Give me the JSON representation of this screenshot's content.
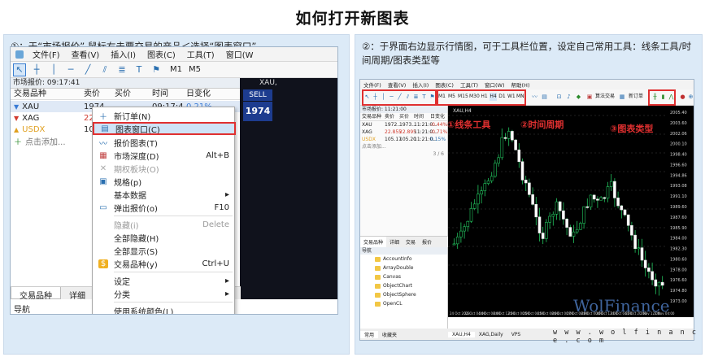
{
  "title": "如何打开新图表",
  "left": {
    "caption": "①：于“市场报价” 鼠标右击要交易的产品＜选择“图表窗口”",
    "menubar": [
      "文件(F)",
      "查看(V)",
      "插入(I)",
      "图表(C)",
      "工具(T)",
      "窗口(W"
    ],
    "timeframes": [
      "M1",
      "M5"
    ],
    "market_watch_header": "市场报价: 09:17:41",
    "columns": [
      "交易品种",
      "卖价",
      "买价",
      "时间",
      "日变化"
    ],
    "rows": [
      {
        "symbol": "XAU",
        "bid": "1974",
        "ask": "",
        "time": "09:17:4",
        "change": "0.21%",
        "color": "#3a7bd5"
      },
      {
        "symbol": "XAG",
        "bid": "22",
        "ask": "",
        "time": "",
        "change": "",
        "color": "#d23b2f"
      },
      {
        "symbol": "USDX",
        "bid": "10",
        "ask": "",
        "time": "",
        "change": "",
        "color": "#e0a020"
      }
    ],
    "add_symbol": "点击添加...",
    "chart_title": "XAU,",
    "sell_label": "SELL",
    "sell_price": "1974",
    "bottom_tabs": [
      "交易品种",
      "详细"
    ],
    "navigator_label": "导航",
    "context_menu": [
      {
        "label": "新订单(N)",
        "shortcut": "",
        "icon": "＋"
      },
      {
        "label": "图表窗口(C)",
        "shortcut": "",
        "icon": "▤"
      },
      {
        "label": "报价图表(T)",
        "shortcut": "",
        "icon": "〰"
      },
      {
        "label": "市场深度(D)",
        "shortcut": "Alt+B",
        "icon": "▦"
      },
      {
        "label": "期权板块(O)",
        "shortcut": "",
        "icon": "✕"
      },
      {
        "label": "规格(p)",
        "shortcut": "",
        "icon": "▣"
      },
      {
        "label": "基本数据",
        "shortcut": "▸",
        "icon": ""
      },
      {
        "label": "弹出报价(o)",
        "shortcut": "F10",
        "icon": "▭"
      },
      {
        "label": "隐藏(i)",
        "shortcut": "Delete",
        "icon": ""
      },
      {
        "label": "全部隐藏(H)",
        "shortcut": "",
        "icon": ""
      },
      {
        "label": "全部显示(S)",
        "shortcut": "",
        "icon": ""
      },
      {
        "label": "交易品种(y)",
        "shortcut": "Ctrl+U",
        "icon": "$"
      },
      {
        "label": "设定",
        "shortcut": "▸",
        "icon": ""
      },
      {
        "label": "分类",
        "shortcut": "▸",
        "icon": ""
      },
      {
        "label": "使用系统颜色(L)",
        "shortcut": "",
        "icon": ""
      }
    ]
  },
  "right": {
    "caption": "②：于界面右边显示行情图，可于工具栏位置，设定自己常用工具：线条工具/时间周期/图表类型等",
    "menubar": [
      "文件(F)",
      "查看(V)",
      "插入(I)",
      "图表(C)",
      "工具(T)",
      "窗口(W)",
      "帮助(H)"
    ],
    "annotations": [
      "①线条工具",
      "②时间周期",
      "③图表类型"
    ],
    "timeframes": [
      "M1",
      "M5",
      "M15",
      "M30",
      "H1",
      "H4",
      "D1",
      "W1",
      "MN"
    ],
    "toolbar_buttons": [
      "算法交易",
      "新订单"
    ],
    "mw_header": "市场报价: 11:21:00",
    "columns": [
      "交易品种",
      "卖价",
      "买价",
      "时间",
      "日变化"
    ],
    "rows": [
      {
        "symbol": "XAU",
        "bid": "1972...",
        "ask": "1973...",
        "time": "11:21:0...",
        "change": "-0.44%"
      },
      {
        "symbol": "XAG",
        "bid": "22.855",
        "ask": "22.895",
        "time": "11:21:0...",
        "change": "-0.71%"
      },
      {
        "symbol": "USDX",
        "bid": "105.17",
        "ask": "105.20",
        "time": "11:21:0...",
        "change": "0.15%"
      }
    ],
    "add_symbol": "点击添加...",
    "page_count": "3 / 6",
    "mw_tabs": [
      "交易品种",
      "详细",
      "交易",
      "报价"
    ],
    "navigator_header": "导航",
    "navigator_items": [
      "AccountInfo",
      "ArrayDouble",
      "Canvas",
      "ObjectChart",
      "ObjectSphere",
      "OpenCL"
    ],
    "nav_bottom_tabs": [
      "常用",
      "收藏夹"
    ],
    "chart_title": "XAU,H4",
    "chart_tabs": [
      "XAU,H4",
      "XAG,Daily",
      "VPS"
    ],
    "price_ticks": [
      "2005.40",
      "2003.60",
      "2002.06",
      "2000.10",
      "1998.40",
      "1996.60",
      "1994.86",
      "1993.08",
      "1991.10",
      "1989.60",
      "1987.60",
      "1985.90",
      "1984.00",
      "1982.30",
      "1980.60",
      "1978.00",
      "1976.60",
      "1974.80",
      "1973.00"
    ],
    "time_ticks": [
      "24 Oct 2023",
      "24 Oct 04:00",
      "24 Oct 08:00",
      "24 Oct 12:00",
      "25 Oct 00:00",
      "25 Oct 04:00",
      "25 Oct 08:00",
      "26 Oct 00:00",
      "27 Oct 08:00",
      "28 Oct 00:00",
      "30 Oct 12:00",
      "31 Oct 04:00",
      "31 Oct 20:00",
      "1 Nov 12:00",
      "2 Nov 04:00"
    ],
    "watermark": "WolFinance",
    "watermark_url": "w w w . w o l f i n a n c e . c o m"
  }
}
